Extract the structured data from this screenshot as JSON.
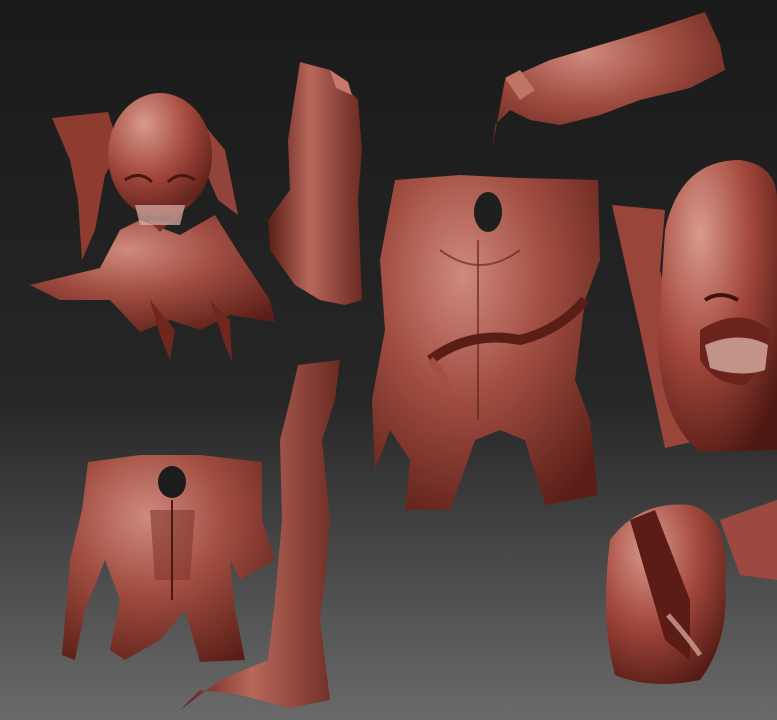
{
  "scene": {
    "description_note": "",
    "colors": {
      "bg_top": "#1a1a1a",
      "bg_mid": "#2b2b2b",
      "bg_bottom": "#6e6e6e",
      "clay_dark": "#4a1a14",
      "clay_mid": "#8a3a30",
      "clay_light": "#b8695c",
      "clay_highlight": "#d9958a"
    },
    "objects": [
      {
        "name": "head-bust-left"
      },
      {
        "name": "forearm-top"
      },
      {
        "name": "hand-top-right"
      },
      {
        "name": "torso-center"
      },
      {
        "name": "head-closeup-right"
      },
      {
        "name": "torso-bottom-left"
      },
      {
        "name": "leg-center"
      },
      {
        "name": "head-bottom-right"
      }
    ]
  }
}
